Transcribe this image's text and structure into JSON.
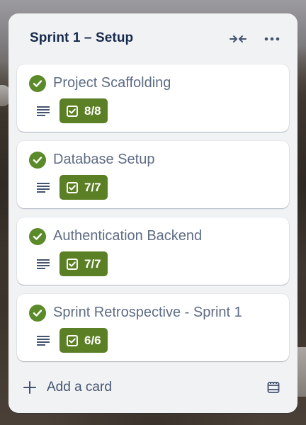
{
  "list": {
    "title": "Sprint 1 – Setup",
    "collapse_icon": "collapse-arrows-icon",
    "more_icon": "more-horizontal-icon"
  },
  "cards": [
    {
      "title": "Project Scaffolding",
      "checklist": "8/8",
      "completed": true
    },
    {
      "title": "Database Setup",
      "checklist": "7/7",
      "completed": true
    },
    {
      "title": "Authentication Backend",
      "checklist": "7/7",
      "completed": true
    },
    {
      "title": "Sprint Retrospective - Sprint 1",
      "checklist": "6/6",
      "completed": true
    }
  ],
  "footer": {
    "add_card_label": "Add a card",
    "template_icon": "card-template-icon"
  },
  "colors": {
    "complete_green": "#5b8a2a",
    "badge_green": "#5b7f24",
    "list_bg": "#f1f2f4"
  }
}
